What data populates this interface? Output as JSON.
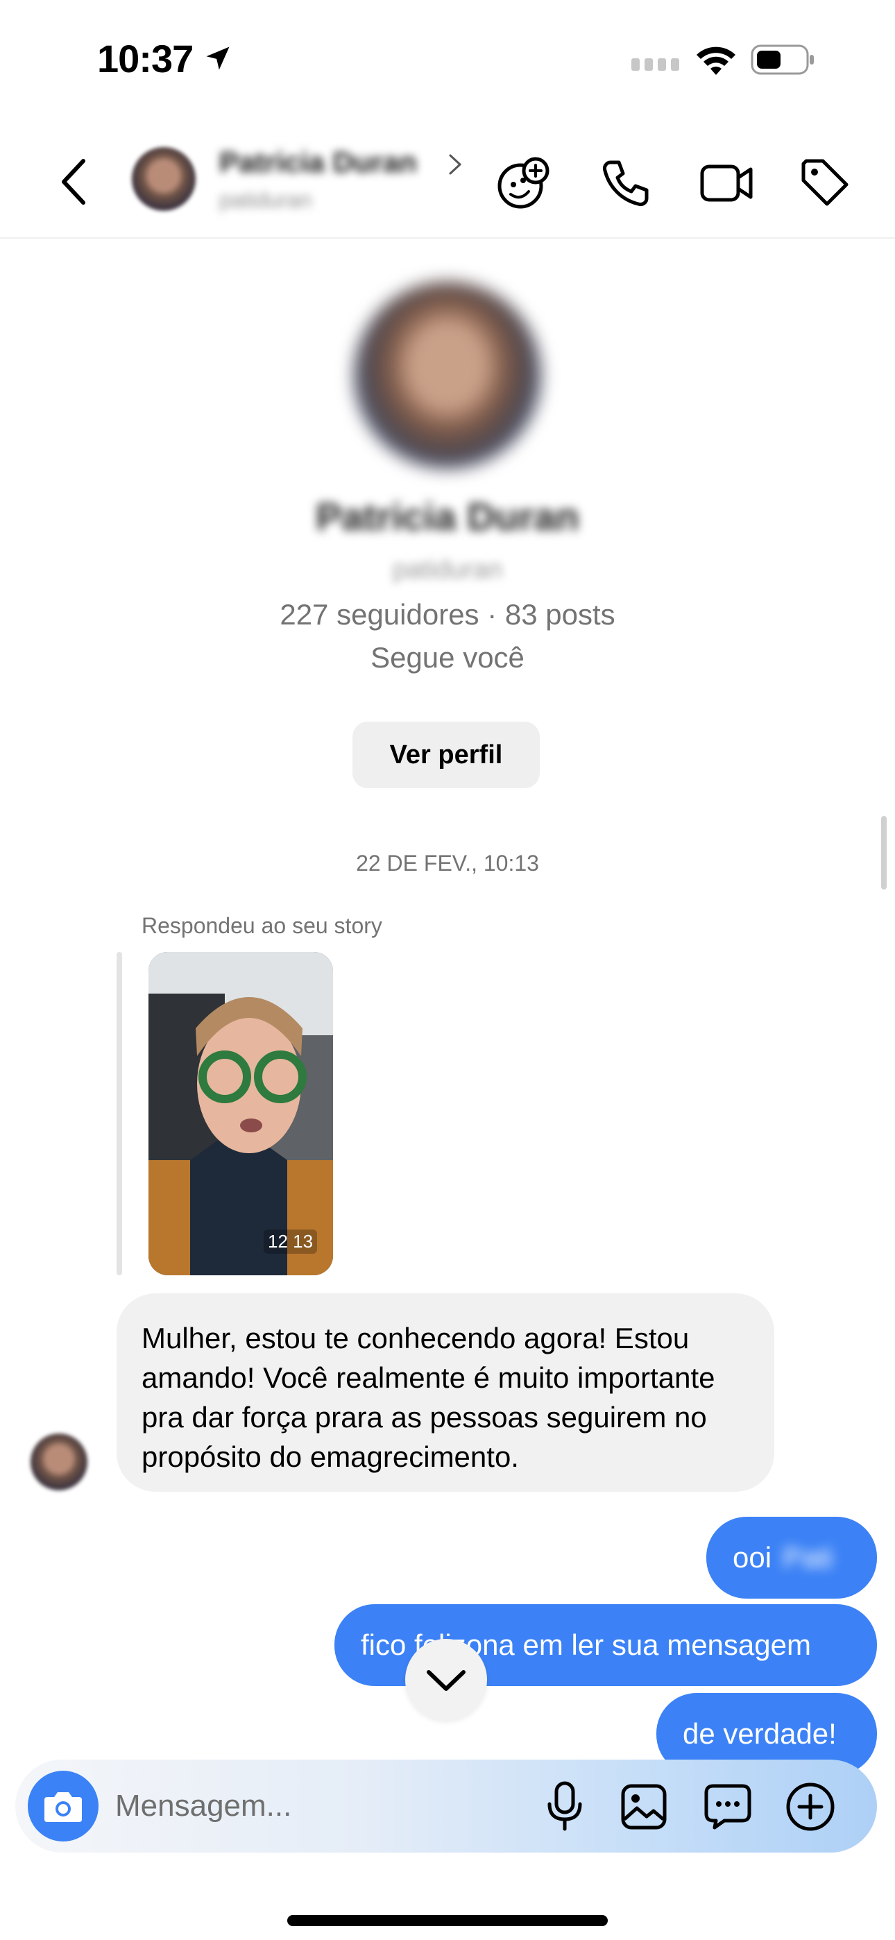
{
  "status_bar": {
    "time": "10:37"
  },
  "header": {
    "name": "Patricia Duran",
    "username": "patiduran"
  },
  "profile": {
    "name": "Patricia Duran",
    "username": "patiduran",
    "stats": "227 seguidores · 83 posts",
    "follows_you": "Segue você",
    "view_profile_label": "Ver perfil"
  },
  "chat": {
    "date_separator": "22 DE FEV., 10:13",
    "reply_label": "Respondeu ao seu story",
    "story_time": "12 13",
    "incoming_message": "Mulher, estou te conhecendo agora! Estou amando! Você realmente é muito importante pra dar força prara as pessoas seguirem no propósito do emagrecimento.",
    "outgoing": [
      {
        "text": "ooi",
        "blurred_text": "Pati"
      },
      {
        "text": "fico felizona em ler sua mensagem"
      },
      {
        "text": "de verdade!"
      }
    ]
  },
  "composer": {
    "placeholder": "Mensagem..."
  },
  "colors": {
    "accent": "#3c82f6",
    "bubble_incoming": "#f1f1f1",
    "secondary_text": "#737373"
  }
}
